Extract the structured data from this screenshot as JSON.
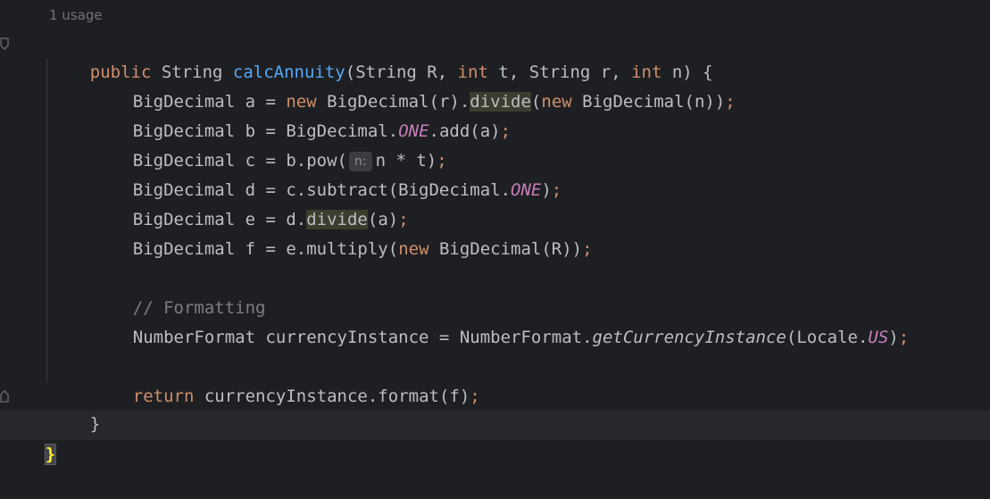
{
  "editor": {
    "usage_hint": "1 usage",
    "param_hint": "n:",
    "lines": {
      "l1_kw": "public",
      "l1_type": " String ",
      "l1_name": "calcAnnuity",
      "l1_p1": "(String R, ",
      "l1_int1": "int",
      "l1_p2": " t, String r, ",
      "l1_int2": "int",
      "l1_p3": " n) {",
      "l2_a": "BigDecimal a = ",
      "l2_new1": "new",
      "l2_b": " BigDecimal(r).",
      "l2_divide": "divide",
      "l2_c": "(",
      "l2_new2": "new",
      "l2_d": " BigDecimal(n))",
      "l2_semi": ";",
      "l3_a": "BigDecimal b = BigDecimal.",
      "l3_one": "ONE",
      "l3_b": ".add(a)",
      "l3_semi": ";",
      "l4_a": "BigDecimal c = b.pow(",
      "l4_b": "n * t)",
      "l4_semi": ";",
      "l5_a": "BigDecimal d = c.subtract(BigDecimal.",
      "l5_one": "ONE",
      "l5_b": ")",
      "l5_semi": ";",
      "l6_a": "BigDecimal e = d.",
      "l6_divide": "divide",
      "l6_b": "(a)",
      "l6_semi": ";",
      "l7_a": "BigDecimal f = e.multiply(",
      "l7_new": "new",
      "l7_b": " BigDecimal(R))",
      "l7_semi": ";",
      "l9_comment": "// Formatting",
      "l10_a": "NumberFormat currencyInstance = NumberFormat.",
      "l10_method": "getCurrencyInstance",
      "l10_b": "(Locale.",
      "l10_us": "US",
      "l10_c": ")",
      "l10_semi": ";",
      "l12_kw": "return",
      "l12_a": " currencyInstance.format(f)",
      "l12_semi": ";",
      "l13_brace": "}",
      "l14_brace": "}"
    },
    "gutter": {
      "mark_top": "⊙",
      "mark_bottom": "⌂"
    }
  },
  "colors": {
    "background": "#1e1f22",
    "keyword": "#cf8e6d",
    "function_decl": "#56a8f5",
    "static_field": "#c77dbb",
    "comment": "#7a7e85",
    "text": "#bcbec4"
  }
}
